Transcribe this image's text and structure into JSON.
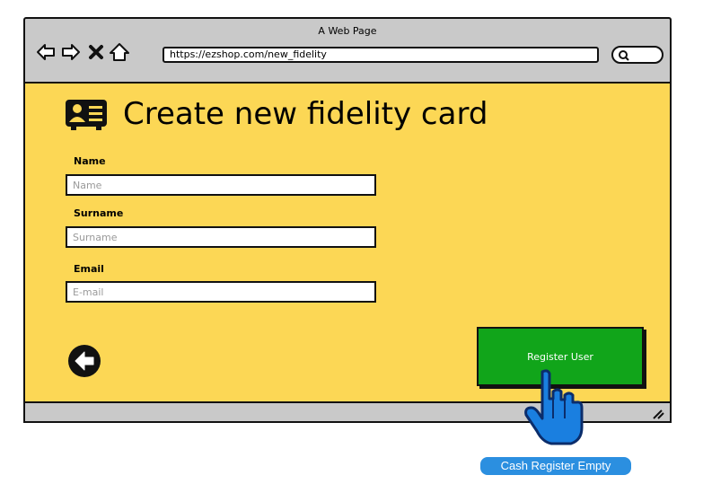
{
  "window": {
    "title": "A Web Page",
    "url": "https://ezshop.com/new_fidelity"
  },
  "page": {
    "title": "Create new fidelity card",
    "title_icon": "id-card-icon"
  },
  "form": {
    "name": {
      "label": "Name",
      "placeholder": "Name",
      "value": ""
    },
    "surname": {
      "label": "Surname",
      "placeholder": "Surname",
      "value": ""
    },
    "email": {
      "label": "Email",
      "placeholder": "E-mail",
      "value": ""
    }
  },
  "buttons": {
    "register_label": "Register User",
    "back_icon": "arrow-left-circle-icon"
  },
  "annotation": {
    "label": "Cash Register Empty"
  },
  "colors": {
    "content_bg": "#fcd755",
    "chrome_bg": "#c9c9c9",
    "register_button": "#11a51a",
    "annotation_bg": "#2b8fe0"
  }
}
